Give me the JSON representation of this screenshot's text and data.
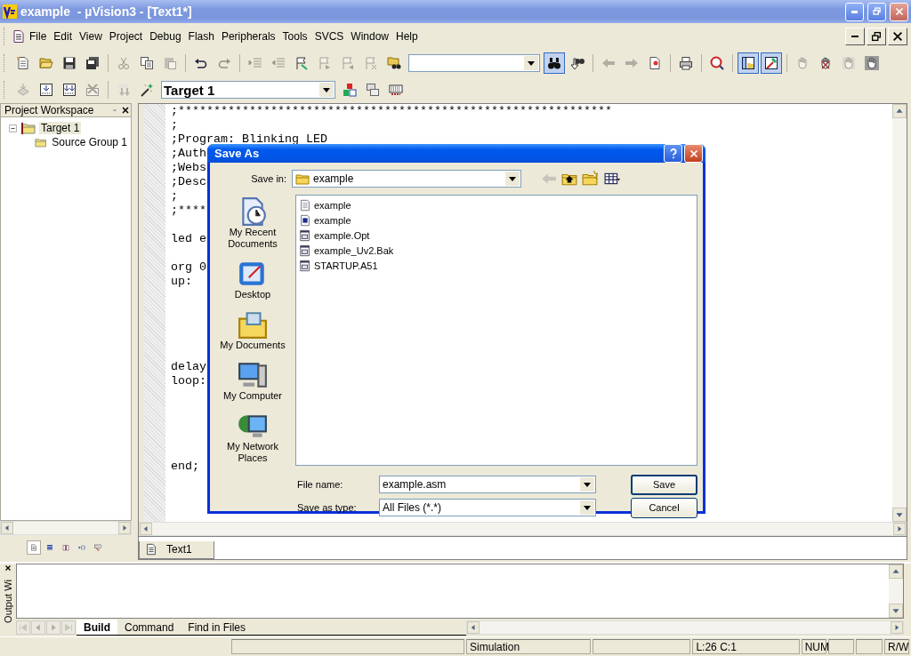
{
  "window": {
    "title": "example  - µVision3 - [Text1*]"
  },
  "menu": [
    {
      "label": "File"
    },
    {
      "label": "Edit"
    },
    {
      "label": "View"
    },
    {
      "label": "Project"
    },
    {
      "label": "Debug"
    },
    {
      "label": "Flash"
    },
    {
      "label": "Peripherals"
    },
    {
      "label": "Tools"
    },
    {
      "label": "SVCS"
    },
    {
      "label": "Window"
    },
    {
      "label": "Help"
    }
  ],
  "toolbar_1": [
    {
      "kind": "new",
      "disabled": false
    },
    {
      "kind": "open",
      "disabled": false
    },
    {
      "kind": "save",
      "disabled": false
    },
    {
      "kind": "save_all",
      "disabled": false
    },
    {
      "kind": "separator"
    },
    {
      "kind": "cut",
      "disabled": true
    },
    {
      "kind": "copy",
      "disabled": false
    },
    {
      "kind": "paste",
      "disabled": true
    },
    {
      "kind": "separator"
    },
    {
      "kind": "undo",
      "disabled": false
    },
    {
      "kind": "redo",
      "disabled": true
    },
    {
      "kind": "separator"
    },
    {
      "kind": "indent",
      "disabled": true
    },
    {
      "kind": "outdent",
      "disabled": true
    },
    {
      "kind": "bookmark",
      "disabled": false
    },
    {
      "kind": "next_bookmark",
      "disabled": true
    },
    {
      "kind": "prev_bookmark",
      "disabled": true
    },
    {
      "kind": "clear_bookmarks",
      "disabled": true
    },
    {
      "kind": "find_in_files",
      "disabled": false
    },
    {
      "kind": "combo"
    },
    {
      "kind": "find",
      "disabled": false,
      "pressed": true
    },
    {
      "kind": "incremental_find",
      "disabled": false
    },
    {
      "kind": "separator"
    },
    {
      "kind": "back",
      "disabled": true
    },
    {
      "kind": "forward",
      "disabled": true
    },
    {
      "kind": "goto",
      "disabled": false
    },
    {
      "kind": "separator"
    },
    {
      "kind": "print",
      "disabled": false
    },
    {
      "kind": "separator"
    },
    {
      "kind": "debug",
      "disabled": false
    },
    {
      "kind": "separator"
    },
    {
      "kind": "workspace",
      "disabled": false,
      "pressed": true
    },
    {
      "kind": "output",
      "disabled": false,
      "pressed": true
    },
    {
      "kind": "separator"
    },
    {
      "kind": "hand",
      "disabled": true
    },
    {
      "kind": "hand_cross",
      "disabled": false
    },
    {
      "kind": "hand_flag",
      "disabled": true
    },
    {
      "kind": "hand_box",
      "disabled": false
    }
  ],
  "toolbar_2": [
    {
      "kind": "translate",
      "disabled": true
    },
    {
      "kind": "build",
      "disabled": false
    },
    {
      "kind": "rebuild",
      "disabled": false
    },
    {
      "kind": "stop",
      "disabled": true
    },
    {
      "kind": "separator"
    },
    {
      "kind": "load",
      "disabled": true
    },
    {
      "kind": "options",
      "disabled": false
    },
    {
      "kind": "combo",
      "value": "Target 1"
    },
    {
      "kind": "components",
      "disabled": false
    },
    {
      "kind": "windows",
      "disabled": false
    },
    {
      "kind": "keyboard",
      "disabled": false
    }
  ],
  "workspace": {
    "title": "Project Workspace",
    "tree": [
      {
        "label": "Target 1",
        "selected": true,
        "expanded": true,
        "children": [
          {
            "label": "Source Group 1",
            "selected": false
          }
        ]
      }
    ],
    "tabs": [
      {
        "kind": "files",
        "selected": true
      },
      {
        "kind": "registers",
        "selected": false
      },
      {
        "kind": "books",
        "selected": false
      },
      {
        "kind": "functions",
        "selected": false
      },
      {
        "kind": "templates",
        "selected": false
      }
    ]
  },
  "editor": {
    "lines": [
      {
        "kind": "code",
        "text": ";*************************************************************"
      },
      {
        "kind": "code",
        "text": ";"
      },
      {
        "kind": "code",
        "text": ";Program: Blinking LED"
      },
      {
        "kind": "code",
        "text": ";Auth"
      },
      {
        "kind": "code",
        "text": ";Webs"
      },
      {
        "kind": "code",
        "text": ";Desc"
      },
      {
        "kind": "code",
        "text": ";"
      },
      {
        "kind": "code",
        "text": ";****"
      },
      {
        "kind": "blank"
      },
      {
        "kind": "code",
        "text": "led e"
      },
      {
        "kind": "blank"
      },
      {
        "kind": "code",
        "text": "org 0"
      },
      {
        "kind": "code",
        "text": "up:"
      },
      {
        "kind": "blank"
      },
      {
        "kind": "blank"
      },
      {
        "kind": "blank"
      },
      {
        "kind": "blank"
      },
      {
        "kind": "blank"
      },
      {
        "kind": "code",
        "text": "delay"
      },
      {
        "kind": "code",
        "text": "loop:"
      },
      {
        "kind": "blank"
      },
      {
        "kind": "blank"
      },
      {
        "kind": "blank"
      },
      {
        "kind": "blank"
      },
      {
        "kind": "blank"
      },
      {
        "kind": "code",
        "text": "end;"
      }
    ],
    "tabs": [
      {
        "label": "Text1",
        "selected": true
      }
    ]
  },
  "dialog": {
    "title": "Save As",
    "save_in": {
      "label": "Save in:",
      "value": "example"
    },
    "places": [
      {
        "kind": "recent",
        "label": "My Recent Documents"
      },
      {
        "kind": "desktop",
        "label": "Desktop"
      },
      {
        "kind": "documents",
        "label": "My Documents"
      },
      {
        "kind": "computer",
        "label": "My Computer"
      },
      {
        "kind": "network",
        "label": "My Network Places"
      }
    ],
    "files": [
      {
        "kind": "text",
        "name": "example"
      },
      {
        "kind": "project",
        "name": "example"
      },
      {
        "kind": "data",
        "name": "example.Opt"
      },
      {
        "kind": "data",
        "name": "example_Uv2.Bak"
      },
      {
        "kind": "data",
        "name": "STARTUP.A51"
      }
    ],
    "file_name": {
      "label": "File name:",
      "value": "example.asm"
    },
    "save_as_type": {
      "label": "Save as type:",
      "value": "All Files (*.*)"
    },
    "buttons": [
      {
        "label": "Save",
        "default": true
      },
      {
        "label": "Cancel",
        "default": false
      }
    ]
  },
  "output": {
    "title": "Output Wi",
    "tabs": [
      {
        "label": "Build",
        "selected": true
      },
      {
        "label": "Command",
        "selected": false
      },
      {
        "label": "Find in Files",
        "selected": false
      }
    ]
  },
  "status_bar": [
    {
      "kind": "empty"
    },
    {
      "kind": "empty"
    },
    {
      "kind": "text",
      "text": "Simulation"
    },
    {
      "kind": "empty"
    },
    {
      "kind": "text",
      "text": "L:26 C:1"
    },
    {
      "kind": "text",
      "text": "NUM"
    },
    {
      "kind": "empty"
    },
    {
      "kind": "empty"
    },
    {
      "kind": "text",
      "text": "R/W"
    }
  ]
}
